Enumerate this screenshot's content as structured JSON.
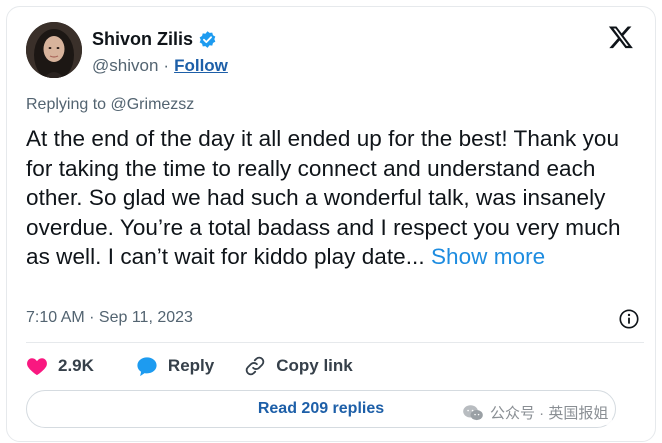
{
  "author": {
    "name": "Shivon Zilis",
    "handle": "@shivon",
    "separator": "·",
    "follow_label": "Follow",
    "verified": true,
    "verified_color": "#1d9bf0"
  },
  "reply_context": "Replying to @Grimezsz",
  "tweet": {
    "text": "At the end of the day it all ended up for the best! Thank you for taking the time to really connect and understand each other. So glad we had such a wonderful talk, was insanely overdue. You’re a total badass and I respect you very much as well. I can’t wait for kiddo play date...",
    "show_more_label": "Show more",
    "timestamp": "7:10 AM · Sep 11, 2023"
  },
  "actions": {
    "likes_count": "2.9K",
    "reply_label": "Reply",
    "copy_link_label": "Copy link"
  },
  "read_replies_label": "Read 209 replies",
  "watermark": "公众号 · 英国报姐",
  "colors": {
    "link": "#1d5fa8",
    "show_more": "#1d8ce0",
    "heart": "#f91880",
    "reply_bubble": "#1d9bf0",
    "secondary_text": "#536471"
  },
  "icons": [
    "verified-badge-icon",
    "x-logo-icon",
    "info-icon",
    "heart-icon",
    "reply-bubble-icon",
    "link-icon",
    "wechat-icon"
  ]
}
